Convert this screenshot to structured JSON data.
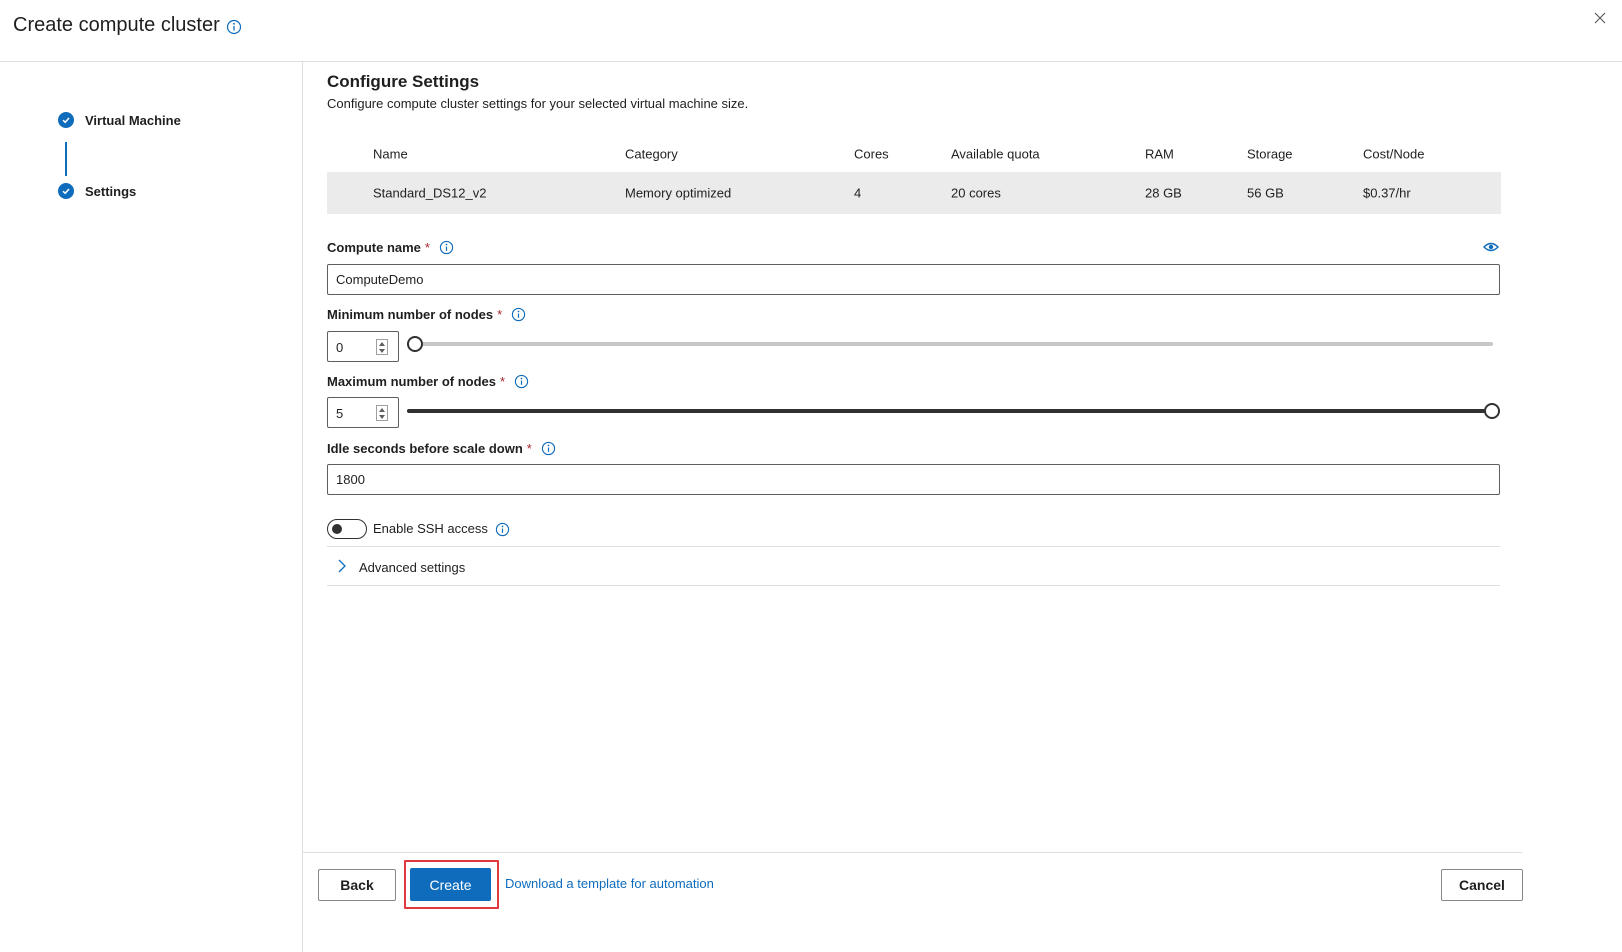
{
  "header": {
    "title": "Create compute cluster",
    "close_label": "×"
  },
  "sidebar": {
    "steps": [
      {
        "label": "Virtual Machine",
        "status": "completed"
      },
      {
        "label": "Settings",
        "status": "current"
      }
    ]
  },
  "main": {
    "heading": "Configure Settings",
    "subtitle": "Configure compute cluster settings for your selected virtual machine size.",
    "vm_table": {
      "columns": [
        "Name",
        "Category",
        "Cores",
        "Available quota",
        "RAM",
        "Storage",
        "Cost/Node"
      ],
      "row": [
        "Standard_DS12_v2",
        "Memory optimized",
        "4",
        "20 cores",
        "28 GB",
        "56 GB",
        "$0.37/hr"
      ]
    },
    "compute_name": {
      "label": "Compute name",
      "required_mark": "*",
      "value": "ComputeDemo"
    },
    "min_nodes": {
      "label": "Minimum number of nodes",
      "required_mark": "*",
      "value": "0",
      "slider_fraction": 0
    },
    "max_nodes": {
      "label": "Maximum number of nodes",
      "required_mark": "*",
      "value": "5",
      "slider_fraction": 1
    },
    "idle_seconds": {
      "label": "Idle seconds before scale down",
      "required_mark": "*",
      "value": "1800"
    },
    "ssh": {
      "label": "Enable SSH access",
      "enabled": false
    },
    "advanced": {
      "label": "Advanced settings"
    }
  },
  "footer": {
    "back_label": "Back",
    "create_label": "Create",
    "download_link": "Download a template for automation",
    "cancel_label": "Cancel"
  },
  "colors": {
    "accent": "#0f6cbd",
    "required": "#a4262c",
    "highlight": "#e03a3e"
  }
}
